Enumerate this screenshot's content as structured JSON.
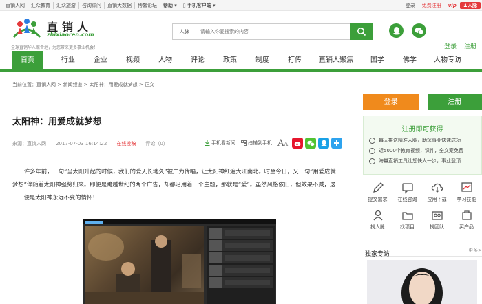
{
  "topbar": {
    "links": [
      "直销人网",
      "汇众教育",
      "汇众旅游",
      "咨询顾问",
      "直销大数据",
      "博鳌论坛",
      "帮助",
      "手机客户端"
    ],
    "login": "登录",
    "register_free": "免费注册",
    "vip": "vip",
    "people": "人脉"
  },
  "logo": {
    "name": "直销人",
    "pinyin": "zhixiaoren.com",
    "slogan": "全球直销华人聚合地，为您带来更多事业机会！"
  },
  "search": {
    "category": "人脉",
    "placeholder": "请输入你要搜索的内容"
  },
  "header_links": {
    "login": "登录",
    "register": "注册"
  },
  "nav": {
    "items": [
      "首页",
      "行业",
      "企业",
      "视频",
      "人物",
      "评论",
      "政策",
      "制度",
      "打传",
      "直销人聚焦",
      "国学",
      "佛学",
      "人物专访"
    ],
    "active": "首页"
  },
  "breadcrumb": "当前位置：直销人网 > 新闻频道 > 太阳神：用爱成就梦想 > 正文",
  "article": {
    "title": "太阳神：用爱成就梦想",
    "source": "来源：直销人网",
    "date": "2017-07-03 16:14:22",
    "contribute": "在线投稿",
    "comments": "评论（0）",
    "mobile_read": "手机看新闻",
    "scan_read": "扫描到手机",
    "body": "许多年前，一句“当太阳升起的时候，我们的爱天长地久”被广为传唱，让太阳神红遍大江南北。时至今日，又一句“用爱成就梦想”伴随着太阳神强势归来。即便是跨越世纪的两个广告，却都沿用着一个主题，那就是“爱”。虽然风格依旧，但效果不减，这一一便是太阳神永远不变的情怀！"
  },
  "sidebar": {
    "login_btn": "登录",
    "register_btn": "注册",
    "reg_title": "注册即可获得",
    "reg_items": [
      "每天推送精准人脉，助您事业快速成功",
      "近5000个教育视频，课件，全文案免费",
      "海量直销工具让您快人一步，事业登顶"
    ],
    "grid": [
      "提交需求",
      "在线咨询",
      "应用下载",
      "学习技能",
      "找人脉",
      "找项目",
      "找团队",
      "买产品"
    ],
    "exclusive_title": "独家专访",
    "more": "更多>"
  },
  "colors": {
    "brand_green": "#3c9f3a",
    "accent_red": "#e4393c",
    "orange": "#f08a1c"
  }
}
